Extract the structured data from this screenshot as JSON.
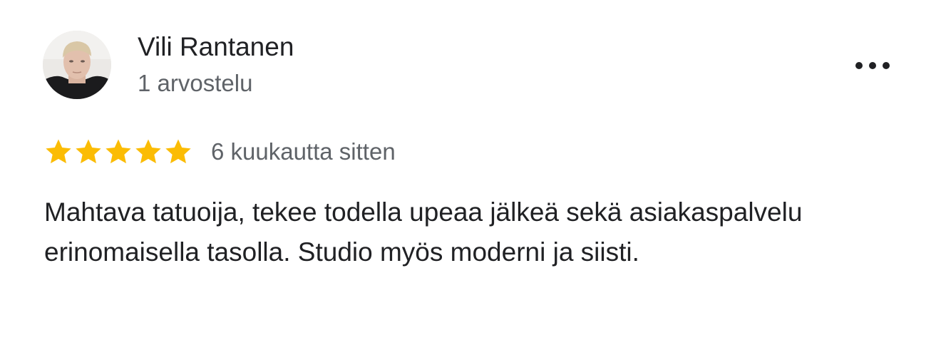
{
  "review": {
    "author_name": "Vili Rantanen",
    "author_meta": "1 arvostelu",
    "rating": 5,
    "rating_max": 5,
    "date": "6 kuukautta sitten",
    "text": "Mahtava tatuoija, tekee todella upeaa jälkeä sekä asiakaspalvelu erinomaisella tasolla. Studio myös moderni ja siisti.",
    "star_color": "#fbbc04",
    "avatar_icon": "user-photo",
    "more_icon": "more-horizontal-icon"
  }
}
